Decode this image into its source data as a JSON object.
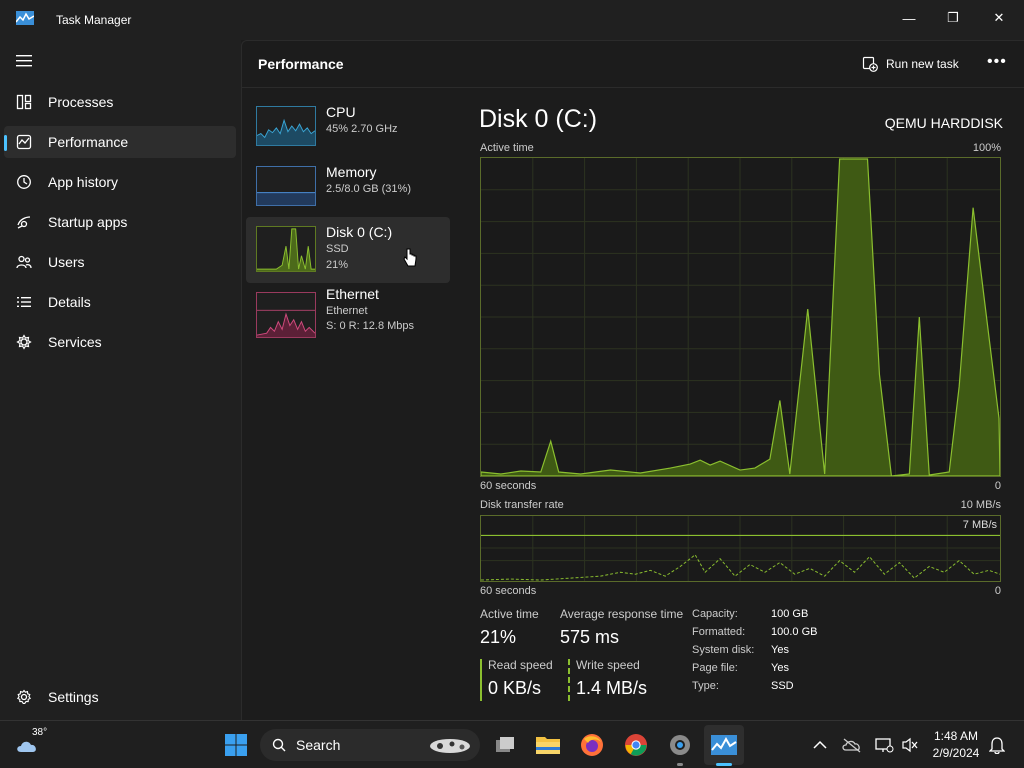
{
  "window": {
    "title": "Task Manager",
    "minimize_glyph": "—",
    "maximize_glyph": "❐",
    "close_glyph": "✕"
  },
  "sidebar": {
    "items": [
      {
        "label": "Processes",
        "icon": "processes-icon"
      },
      {
        "label": "Performance",
        "icon": "performance-icon",
        "active": true
      },
      {
        "label": "App history",
        "icon": "app-history-icon"
      },
      {
        "label": "Startup apps",
        "icon": "startup-apps-icon"
      },
      {
        "label": "Users",
        "icon": "users-icon"
      },
      {
        "label": "Details",
        "icon": "details-icon"
      },
      {
        "label": "Services",
        "icon": "services-icon"
      }
    ],
    "settings_label": "Settings"
  },
  "header": {
    "title": "Performance",
    "run_new_task": "Run new task",
    "more": "•••"
  },
  "resources": [
    {
      "name": "CPU",
      "line1": "45%  2.70 GHz",
      "line2": ""
    },
    {
      "name": "Memory",
      "line1": "2.5/8.0 GB (31%)",
      "line2": ""
    },
    {
      "name": "Disk 0 (C:)",
      "line1": "SSD",
      "line2": "21%",
      "active": true
    },
    {
      "name": "Ethernet",
      "line1": "Ethernet",
      "line2": "S: 0  R: 12.8 Mbps"
    }
  ],
  "disk": {
    "title": "Disk 0 (C:)",
    "model": "QEMU HARDDISK",
    "active_time_label": "Active time",
    "active_time_max": "100%",
    "seconds_label": "60 seconds",
    "zero": "0",
    "transfer_label": "Disk transfer rate",
    "transfer_max": "10 MB/s",
    "transfer_marker": "7 MB/s",
    "stats": {
      "active_time_label": "Active time",
      "active_time_value": "21%",
      "avg_response_label": "Average response time",
      "avg_response_value": "575 ms",
      "read_label": "Read speed",
      "read_value": "0 KB/s",
      "write_label": "Write speed",
      "write_value": "1.4 MB/s"
    },
    "properties": [
      {
        "key": "Capacity:",
        "value": "100 GB"
      },
      {
        "key": "Formatted:",
        "value": "100.0 GB"
      },
      {
        "key": "System disk:",
        "value": "Yes"
      },
      {
        "key": "Page file:",
        "value": "Yes"
      },
      {
        "key": "Type:",
        "value": "SSD"
      }
    ]
  },
  "taskbar": {
    "weather_temp": "38°",
    "search_label": "Search",
    "time": "1:48 AM",
    "date": "2/9/2024"
  },
  "colors": {
    "accent": "#4cc2ff",
    "disk": "#8bbf2f",
    "disk_fill": "#4c6a1a",
    "cpu": "#3aa6d6",
    "memory": "#4b8fd9",
    "ethernet": "#d04b7e"
  }
}
